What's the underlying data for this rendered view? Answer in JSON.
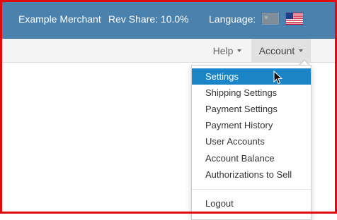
{
  "header": {
    "merchant": "Example Merchant",
    "rev_share": "Rev Share: 10.0%",
    "language_label": "Language:",
    "flags": [
      "china-flag-icon",
      "usa-flag-icon"
    ]
  },
  "nav": {
    "help": "Help",
    "account": "Account"
  },
  "account_menu": {
    "items": [
      {
        "label": "Settings",
        "active": true
      },
      {
        "label": "Shipping Settings"
      },
      {
        "label": "Payment Settings"
      },
      {
        "label": "Payment History"
      },
      {
        "label": "User Accounts"
      },
      {
        "label": "Account Balance"
      },
      {
        "label": "Authorizations to Sell"
      }
    ],
    "logout": "Logout"
  },
  "colors": {
    "header_bg": "#4a81ad",
    "active_item": "#1a84c7",
    "frame": "#e10b0b"
  }
}
